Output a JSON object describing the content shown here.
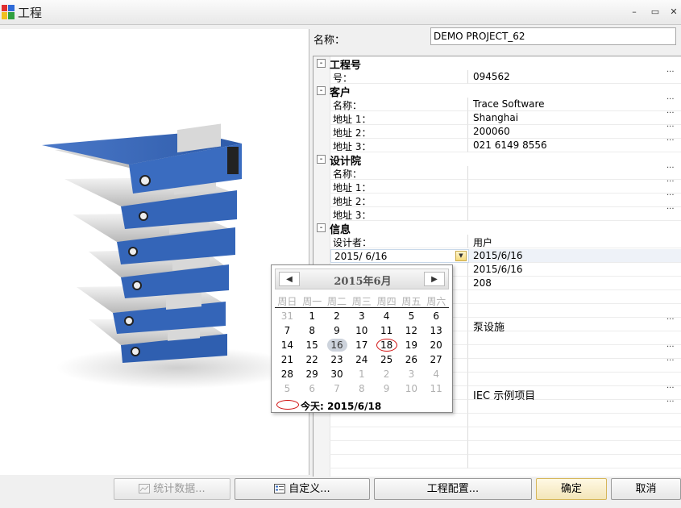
{
  "window": {
    "title": "工程",
    "min_glyph": "–",
    "max_glyph": "▭",
    "close_glyph": "✕"
  },
  "name_field": {
    "label": "名称：",
    "value": "DEMO PROJECT_62"
  },
  "properties": {
    "dots": "···",
    "toggle": "-",
    "project_no": {
      "category": "工程号",
      "rows": [
        {
          "key": "号：",
          "value": "094562"
        }
      ]
    },
    "client": {
      "category": "客户",
      "rows": [
        {
          "key": "名称：",
          "value": "Trace Software"
        },
        {
          "key": "地址 1：",
          "value": "Shanghai"
        },
        {
          "key": "地址 2：",
          "value": "200060"
        },
        {
          "key": "地址 3：",
          "value": "021 6149 8556"
        }
      ]
    },
    "design_institute": {
      "category": "设计院",
      "rows": [
        {
          "key": "名称：",
          "value": ""
        },
        {
          "key": "地址 1：",
          "value": ""
        },
        {
          "key": "地址 2：",
          "value": ""
        },
        {
          "key": "地址 3：",
          "value": ""
        }
      ]
    },
    "info": {
      "category": "信息",
      "rows": [
        {
          "key": "设计者：",
          "value": "用户"
        },
        {
          "key": "2015/  6/16",
          "value": "2015/6/16"
        },
        {
          "key": "",
          "value": "2015/6/16"
        },
        {
          "key": "",
          "value": "208"
        },
        {
          "key": "",
          "value": ""
        },
        {
          "key": "",
          "value": "泵设施"
        },
        {
          "key": "",
          "value": ""
        },
        {
          "key": "",
          "value": ""
        },
        {
          "key": "",
          "value": ""
        },
        {
          "key": "",
          "value": ""
        },
        {
          "key": "",
          "value": ""
        },
        {
          "key": "",
          "value": "IEC 示例项目"
        },
        {
          "key": "",
          "value": ""
        }
      ]
    }
  },
  "calendar": {
    "title": "2015年6月",
    "prev": "◀",
    "next": "▶",
    "weekdays": [
      "周日",
      "周一",
      "周二",
      "周三",
      "周四",
      "周五",
      "周六"
    ],
    "days": [
      {
        "d": "31",
        "other": true
      },
      {
        "d": "1"
      },
      {
        "d": "2"
      },
      {
        "d": "3"
      },
      {
        "d": "4"
      },
      {
        "d": "5"
      },
      {
        "d": "6"
      },
      {
        "d": "7"
      },
      {
        "d": "8"
      },
      {
        "d": "9"
      },
      {
        "d": "10"
      },
      {
        "d": "11"
      },
      {
        "d": "12"
      },
      {
        "d": "13"
      },
      {
        "d": "14"
      },
      {
        "d": "15"
      },
      {
        "d": "16",
        "selected": true
      },
      {
        "d": "17"
      },
      {
        "d": "18",
        "today": true
      },
      {
        "d": "19"
      },
      {
        "d": "20"
      },
      {
        "d": "21"
      },
      {
        "d": "22"
      },
      {
        "d": "23"
      },
      {
        "d": "24"
      },
      {
        "d": "25"
      },
      {
        "d": "26"
      },
      {
        "d": "27"
      },
      {
        "d": "28"
      },
      {
        "d": "29"
      },
      {
        "d": "30"
      },
      {
        "d": "1",
        "other": true
      },
      {
        "d": "2",
        "other": true
      },
      {
        "d": "3",
        "other": true
      },
      {
        "d": "4",
        "other": true
      },
      {
        "d": "5",
        "other": true
      },
      {
        "d": "6",
        "other": true
      },
      {
        "d": "7",
        "other": true
      },
      {
        "d": "8",
        "other": true
      },
      {
        "d": "9",
        "other": true
      },
      {
        "d": "10",
        "other": true
      },
      {
        "d": "11",
        "other": true
      }
    ],
    "today_label": "今天: 2015/6/18"
  },
  "buttons": {
    "statistics": "统计数据...",
    "custom": "自定义...",
    "project_config": "工程配置...",
    "ok": "确定",
    "cancel": "取消"
  }
}
